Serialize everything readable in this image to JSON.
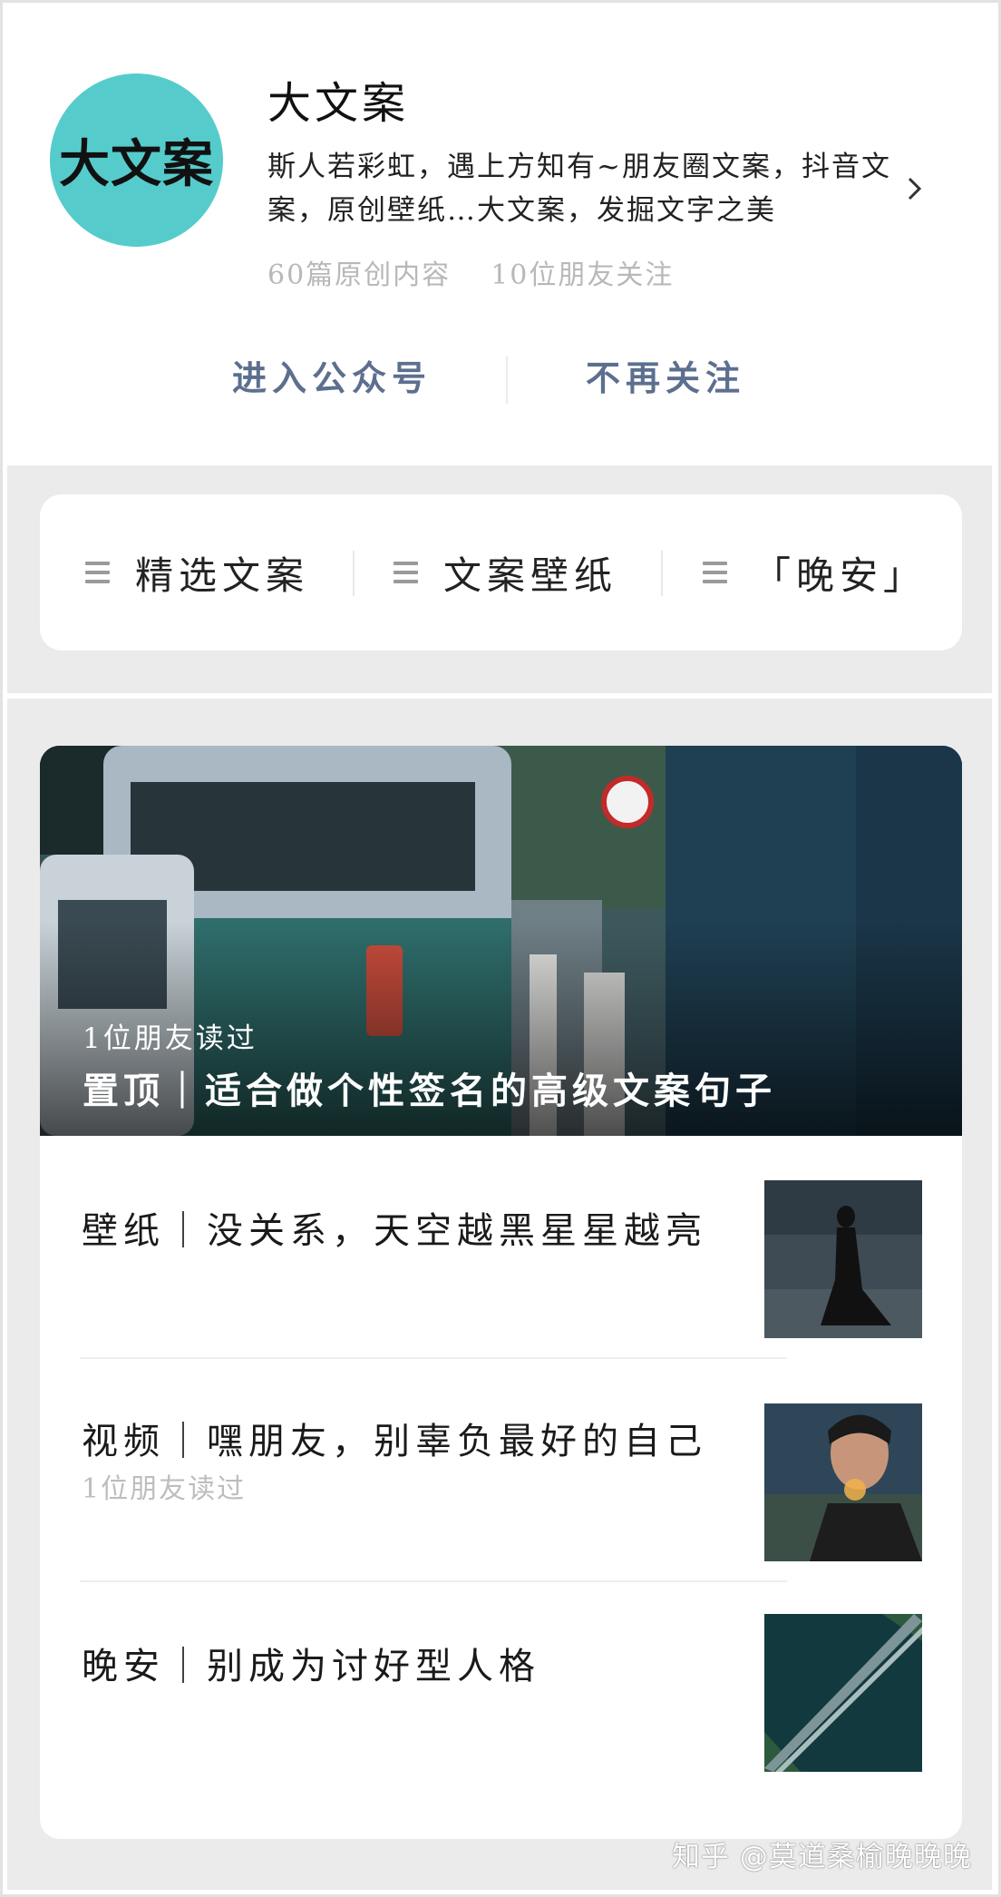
{
  "account": {
    "avatar_text": "大文案",
    "name": "大文案",
    "description": "斯人若彩虹，遇上方知有~朋友圈文案，抖音文案，原创壁纸…大文案，发掘文字之美",
    "original_count": "60篇原创内容",
    "friends_following": "10位朋友关注",
    "avatar_color": "#55cccb"
  },
  "actions": {
    "enter": "进入公众号",
    "unfollow": "不再关注",
    "color": "#5d6f8f"
  },
  "menu": {
    "items": [
      {
        "label": "精选文案",
        "icon": "hamburger-icon"
      },
      {
        "label": "文案壁纸",
        "icon": "hamburger-icon"
      },
      {
        "label": "「晚安」",
        "icon": "hamburger-icon"
      }
    ]
  },
  "featured": {
    "read_by": "1位朋友读过",
    "title": "置顶｜适合做个性签名的高级文案句子"
  },
  "articles": [
    {
      "title": "壁纸｜没关系，天空越黑星星越亮",
      "read_by": ""
    },
    {
      "title": "视频｜嘿朋友，别辜负最好的自己",
      "read_by": "1位朋友读过"
    },
    {
      "title": "晚安｜别成为讨好型人格",
      "read_by": ""
    }
  ],
  "watermark": "知乎 @莫道桑榆晚晚晚"
}
